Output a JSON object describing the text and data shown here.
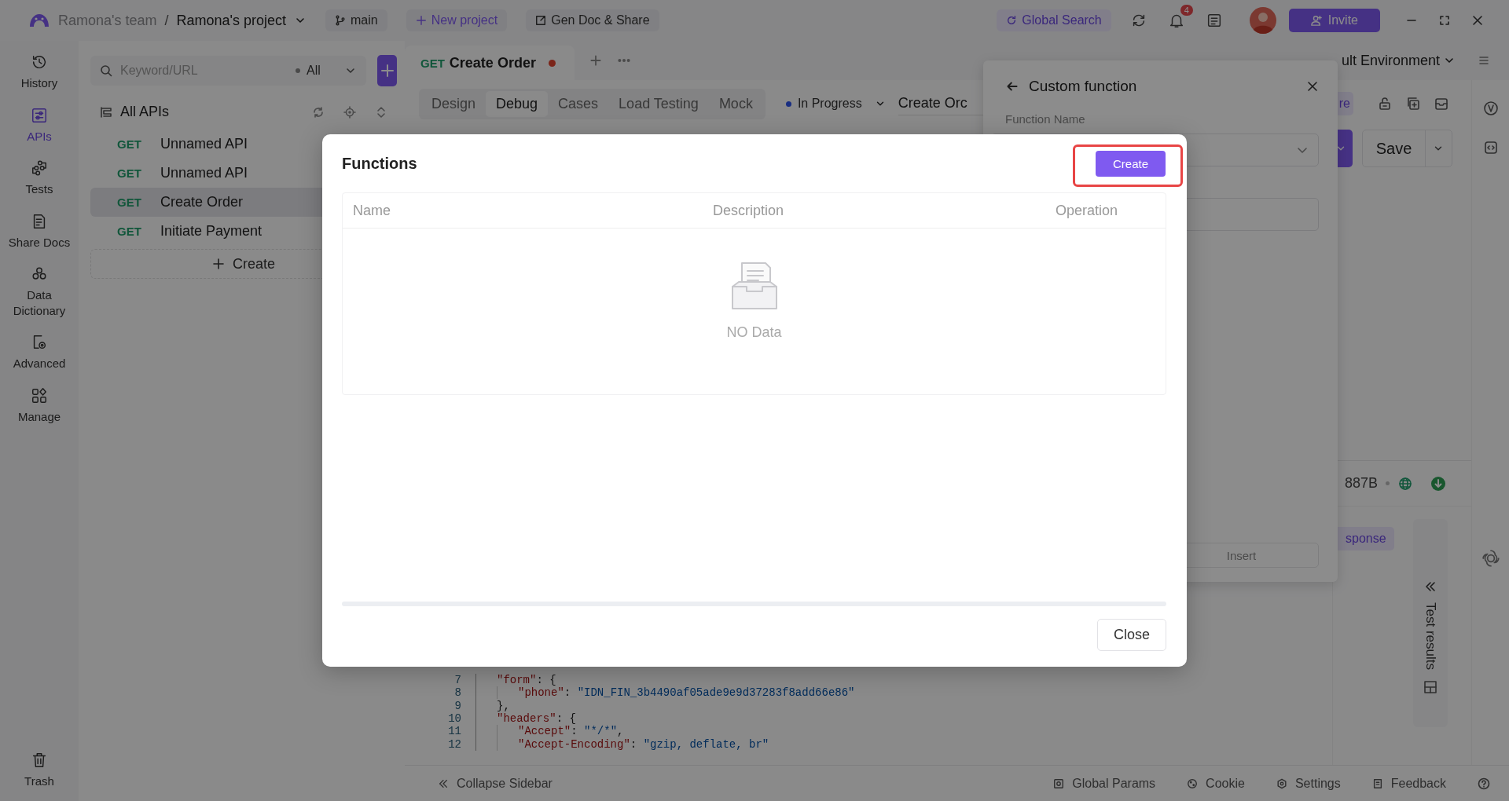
{
  "title_bar": {
    "team": "Ramona's team",
    "separator": "/",
    "project": "Ramona's project",
    "branch": "main",
    "new_project": "New project",
    "gen_doc": "Gen Doc & Share",
    "global_search": "Global Search",
    "notifications": "4",
    "invite": "Invite"
  },
  "nav": [
    {
      "label": "History",
      "selected": false
    },
    {
      "label": "APIs",
      "selected": true
    },
    {
      "label": "Tests",
      "selected": false
    },
    {
      "label": "Share Docs",
      "selected": false
    },
    {
      "label": "Data Dictionary",
      "selected": false
    },
    {
      "label": "Advanced",
      "selected": false
    },
    {
      "label": "Manage",
      "selected": false
    }
  ],
  "nav_bottom": {
    "label": "Trash"
  },
  "api_panel": {
    "search_placeholder": "Keyword/URL",
    "filter": "All",
    "tree_title": "All APIs",
    "items": [
      {
        "method": "GET",
        "name": "Unnamed API",
        "selected": false
      },
      {
        "method": "GET",
        "name": "Unnamed API",
        "selected": false
      },
      {
        "method": "GET",
        "name": "Create Order",
        "selected": true
      },
      {
        "method": "GET",
        "name": "Initiate Payment",
        "selected": false
      }
    ],
    "create": "Create"
  },
  "editor": {
    "tab": {
      "method": "GET",
      "title": "Create Order",
      "unsaved": true
    },
    "subtabs": [
      {
        "label": "Design",
        "selected": false
      },
      {
        "label": "Debug",
        "selected": true
      },
      {
        "label": "Cases",
        "selected": false
      },
      {
        "label": "Load Testing",
        "selected": false
      },
      {
        "label": "Mock",
        "selected": false
      }
    ],
    "status": "In Progress",
    "name_value": "Create Orc",
    "environment": "ult Environment",
    "partial_button": "re",
    "save": "Save",
    "size": "887B",
    "response_tab": "sponse",
    "test_results": "Test results",
    "code_lines": [
      {
        "number": "7",
        "nested": false,
        "tokens": [
          {
            "kind": "key",
            "text": "\"form\""
          },
          {
            "kind": "punct",
            "text": ": {"
          }
        ]
      },
      {
        "number": "8",
        "nested": true,
        "tokens": [
          {
            "kind": "key",
            "text": "\"phone\""
          },
          {
            "kind": "punct",
            "text": ": "
          },
          {
            "kind": "string",
            "text": "\"IDN_FIN_3b4490af05ade9e9d37283f8add66e86\""
          }
        ]
      },
      {
        "number": "9",
        "nested": false,
        "tokens": [
          {
            "kind": "punct",
            "text": "},"
          }
        ]
      },
      {
        "number": "10",
        "nested": false,
        "tokens": [
          {
            "kind": "key",
            "text": "\"headers\""
          },
          {
            "kind": "punct",
            "text": ": {"
          }
        ]
      },
      {
        "number": "11",
        "nested": true,
        "tokens": [
          {
            "kind": "key",
            "text": "\"Accept\""
          },
          {
            "kind": "punct",
            "text": ": "
          },
          {
            "kind": "string",
            "text": "\"*/*\""
          },
          {
            "kind": "punct",
            "text": ","
          }
        ]
      },
      {
        "number": "12",
        "nested": true,
        "tokens": [
          {
            "kind": "key",
            "text": "\"Accept-Encoding\""
          },
          {
            "kind": "punct",
            "text": ": "
          },
          {
            "kind": "string",
            "text": "\"gzip, deflate, br\""
          }
        ]
      }
    ]
  },
  "custom_function": {
    "title": "Custom function",
    "field_label": "Function Name",
    "insert": "Insert"
  },
  "modal": {
    "title": "Functions",
    "create": "Create",
    "create_highlighted": true,
    "columns": [
      "Name",
      "Description",
      "Operation"
    ],
    "empty_text": "NO Data",
    "close": "Close"
  },
  "status_bar": {
    "collapse": "Collapse Sidebar",
    "items": [
      "Global Params",
      "Cookie",
      "Settings",
      "Feedback"
    ]
  }
}
